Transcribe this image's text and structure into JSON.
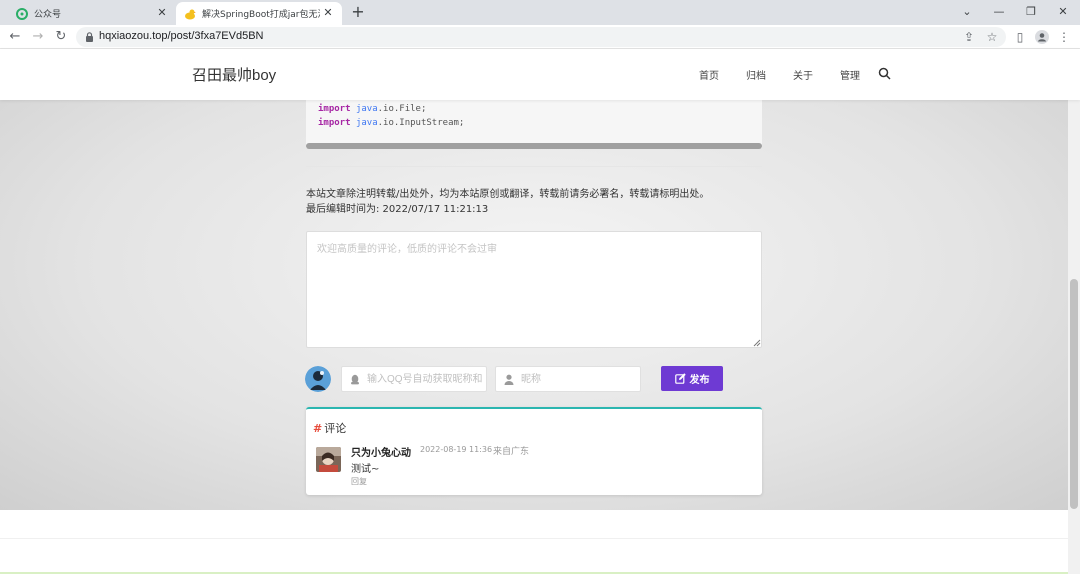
{
  "browser": {
    "tabs": [
      {
        "title": "公众号",
        "icon": "wechat-channels-icon"
      },
      {
        "title": "解决SpringBoot打成jar包无法加",
        "icon": "duck-icon"
      }
    ],
    "new_tab_label": "+",
    "url": "hqxiaozou.top/post/3fxa7EVd5BN"
  },
  "site": {
    "logo": "召田最帅boy",
    "menu": [
      "首页",
      "归档",
      "关于",
      "管理"
    ]
  },
  "article": {
    "code_lines": [
      {
        "kw": "import",
        "pkg": "java",
        "rest": ".io.File;"
      },
      {
        "kw": "import",
        "pkg": "java",
        "rest": ".io.InputStream;"
      }
    ],
    "copyright_notice": "本站文章除注明转载/出处外，均为本站原创或翻译，转载前请务必署名，转载请标明出处。",
    "last_edit": "最后编辑时间为: 2022/07/17 11:21:13"
  },
  "comment_form": {
    "textarea_placeholder": "欢迎高质量的评论，低质的评论不会过审",
    "qq_placeholder": "输入QQ号自动获取昵称和头像",
    "nickname_placeholder": "昵称",
    "publish_label": "发布",
    "accent_color": "#6e3ad3"
  },
  "comments": {
    "heading": "评论",
    "heading_mark": "#",
    "items": [
      {
        "author": "只为小兔心动",
        "time": "2022-08-19 11:36",
        "location": "来自广东",
        "text": "测试~",
        "reply_label": "回复"
      }
    ]
  }
}
